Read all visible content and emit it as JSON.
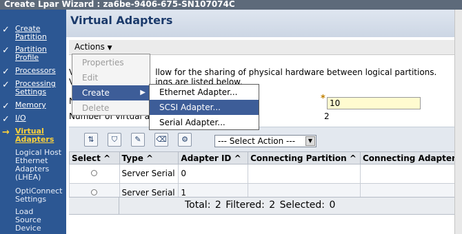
{
  "window": {
    "title": "Create Lpar Wizard : za6be-9406-675-SN107074C"
  },
  "nav": {
    "items": [
      {
        "label": "Create\nPartition",
        "state": "done"
      },
      {
        "label": "Partition\nProfile",
        "state": "done"
      },
      {
        "label": "Processors",
        "state": "done"
      },
      {
        "label": "Processing\nSettings",
        "state": "done"
      },
      {
        "label": "Memory",
        "state": "done"
      },
      {
        "label": "I/O",
        "state": "done"
      },
      {
        "label": "Virtual\nAdapters",
        "state": "current"
      },
      {
        "label": "Logical Host\nEthernet\nAdapters\n(LHEA)",
        "state": "pending"
      },
      {
        "label": "OptiConnect\nSettings",
        "state": "pending"
      },
      {
        "label": "Load\nSource\nDevice",
        "state": "pending"
      }
    ]
  },
  "page": {
    "title": "Virtual Adapters",
    "actions_label": "Actions",
    "description_line1": "V",
    "description_line1b": "llow for the sharing of physical hardware between logical partitions.",
    "description_line2": "V",
    "description_line2b": "ings are listed below.",
    "max_label": "N",
    "max_value": "10",
    "number_label": "Number of virtual a",
    "number_value": "2"
  },
  "actions_menu": {
    "items": [
      {
        "label": "Properties",
        "enabled": false
      },
      {
        "label": "Edit",
        "enabled": false
      },
      {
        "label": "Create",
        "enabled": true,
        "active": true
      },
      {
        "label": "Delete",
        "enabled": false
      }
    ]
  },
  "create_submenu": {
    "items": [
      {
        "label": "Ethernet Adapter..."
      },
      {
        "label": "SCSI Adapter...",
        "hover": true
      },
      {
        "label": "Serial Adapter..."
      }
    ]
  },
  "toolbar": {
    "select_action_label": "--- Select Action ---",
    "icons": [
      "columns-icon",
      "filter-icon",
      "edit-sort-icon",
      "clear-icon",
      "configure-icon"
    ]
  },
  "table": {
    "headers": [
      "Select",
      "Type",
      "Adapter ID",
      "Connecting Partition",
      "Connecting Adapter"
    ],
    "rows": [
      {
        "type": "Server Serial",
        "adapter_id": "0",
        "connecting_partition": "",
        "connecting_adapter": ""
      },
      {
        "type": "Server Serial",
        "adapter_id": "1",
        "connecting_partition": "",
        "connecting_adapter": ""
      }
    ],
    "footer": "Total: 2   Filtered: 2   Selected: 0"
  }
}
